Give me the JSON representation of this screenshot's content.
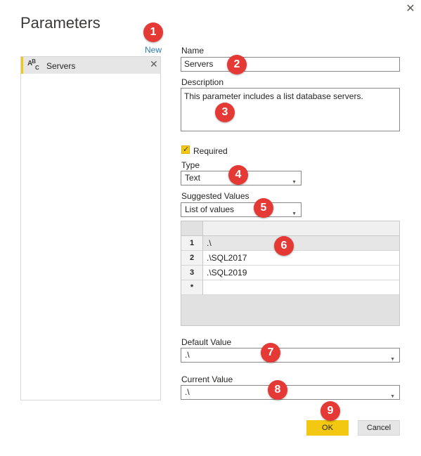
{
  "dialog": {
    "title": "Parameters",
    "close_glyph": "✕"
  },
  "list": {
    "new_label": "New",
    "items": [
      {
        "type_glyph_a": "A",
        "type_glyph_b": "B",
        "type_glyph_c": "C",
        "name": "Servers",
        "delete_glyph": "✕"
      }
    ]
  },
  "form": {
    "name_label": "Name",
    "name_value": "Servers",
    "description_label": "Description",
    "description_value": "This parameter includes a list database servers.",
    "required_label": "Required",
    "required_checked": true,
    "type_label": "Type",
    "type_value": "Text",
    "suggested_label": "Suggested Values",
    "suggested_value": "List of values",
    "default_label": "Default Value",
    "default_value": ".\\",
    "current_label": "Current Value",
    "current_value": ".\\"
  },
  "grid": {
    "rows": [
      {
        "num": "1",
        "value": ".\\"
      },
      {
        "num": "2",
        "value": ".\\SQL2017"
      },
      {
        "num": "3",
        "value": ".\\SQL2019"
      },
      {
        "num": "*",
        "value": ""
      }
    ]
  },
  "buttons": {
    "ok": "OK",
    "cancel": "Cancel"
  },
  "markers": [
    "1",
    "2",
    "3",
    "4",
    "5",
    "6",
    "7",
    "8",
    "9"
  ],
  "colors": {
    "accent": "#f2c811",
    "link": "#2b7bb9",
    "marker": "#e53935"
  },
  "icons": {
    "caret": "▼",
    "check": "✓"
  }
}
